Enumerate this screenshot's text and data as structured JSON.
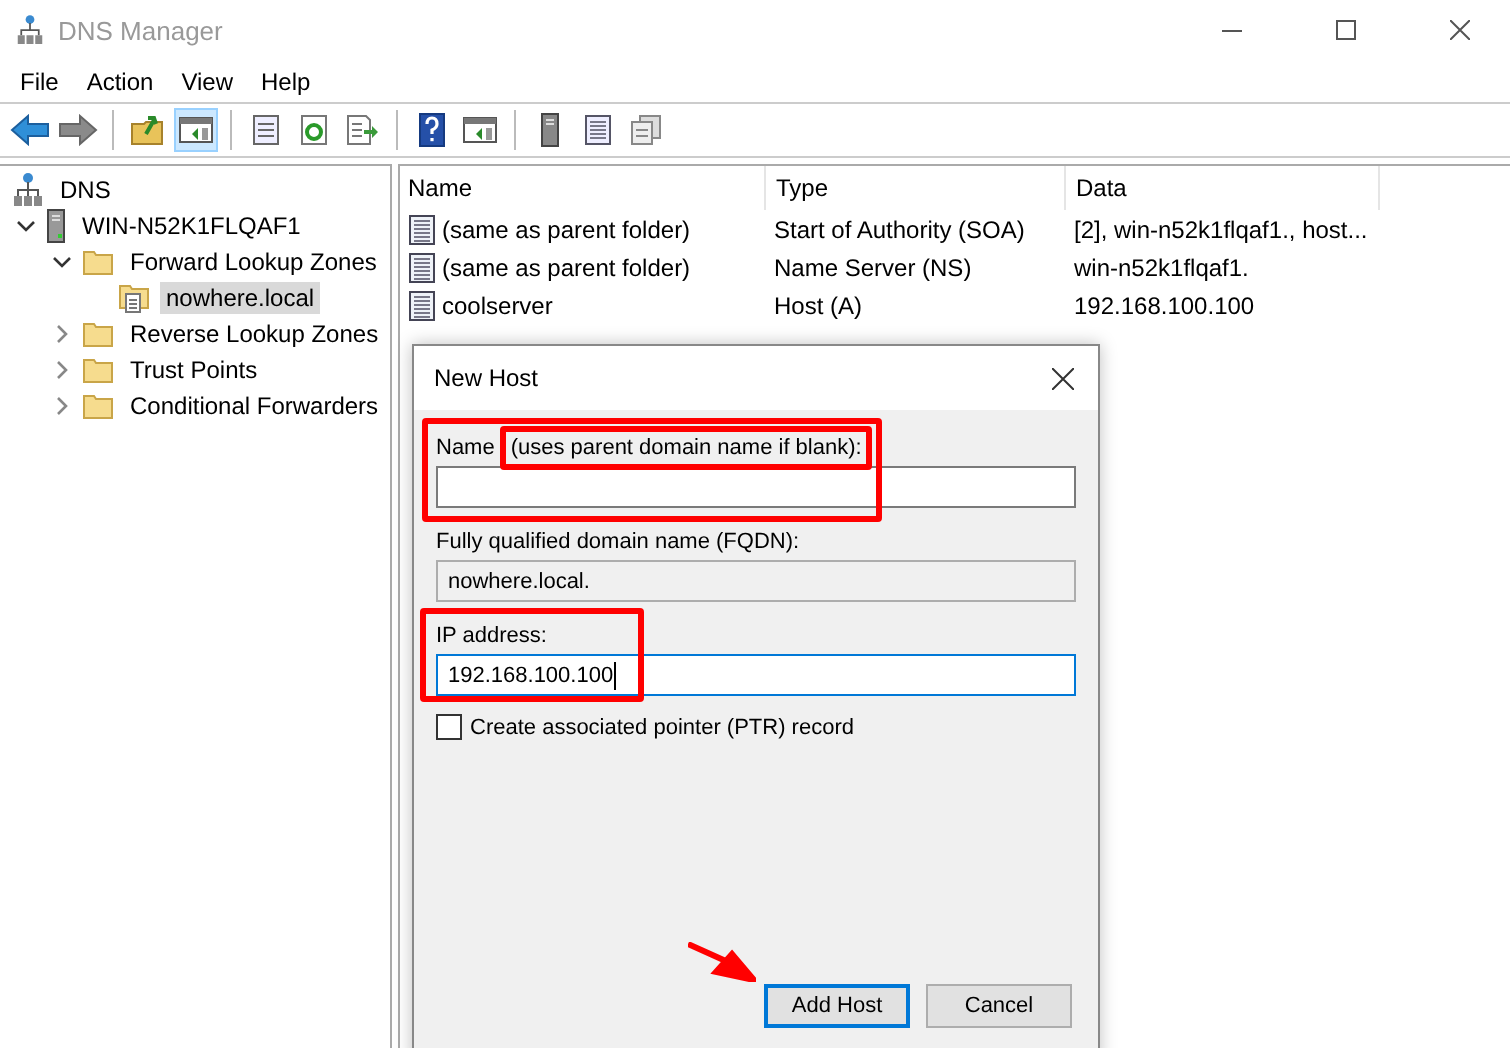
{
  "window": {
    "title": "DNS Manager"
  },
  "menu": [
    "File",
    "Action",
    "View",
    "Help"
  ],
  "toolbar": [
    {
      "kind": "back",
      "pressed": false
    },
    {
      "kind": "forward",
      "pressed": false
    },
    {
      "kind": "separator"
    },
    {
      "kind": "up-folder",
      "pressed": false
    },
    {
      "kind": "pane",
      "pressed": true
    },
    {
      "kind": "separator"
    },
    {
      "kind": "properties",
      "pressed": false
    },
    {
      "kind": "refresh",
      "pressed": false
    },
    {
      "kind": "export",
      "pressed": false
    },
    {
      "kind": "separator"
    },
    {
      "kind": "help",
      "pressed": false
    },
    {
      "kind": "pane",
      "pressed": false
    },
    {
      "kind": "separator"
    },
    {
      "kind": "server",
      "pressed": false
    },
    {
      "kind": "list",
      "pressed": false
    },
    {
      "kind": "copy",
      "pressed": false
    }
  ],
  "tree": [
    {
      "label": "DNS",
      "kind": "dns",
      "selected": false,
      "children": [
        {
          "label": "WIN-N52K1FLQAF1",
          "kind": "server",
          "expanded": true,
          "selected": false,
          "children": [
            {
              "label": "Forward Lookup Zones",
              "kind": "folder",
              "expanded": true,
              "selected": false,
              "children": [
                {
                  "label": "nowhere.local",
                  "kind": "zone",
                  "selected": true
                }
              ]
            },
            {
              "label": "Reverse Lookup Zones",
              "kind": "folder",
              "expanded": false,
              "selected": false
            },
            {
              "label": "Trust Points",
              "kind": "folder",
              "expanded": false,
              "selected": false
            },
            {
              "label": "Conditional Forwarders",
              "kind": "folder",
              "expanded": false,
              "selected": false
            }
          ]
        }
      ]
    }
  ],
  "table": {
    "columns": [
      "Name",
      "Type",
      "Data"
    ],
    "rows": [
      {
        "name": "(same as parent folder)",
        "type": "Start of Authority (SOA)",
        "data": "[2], win-n52k1flqaf1., host..."
      },
      {
        "name": "(same as parent folder)",
        "type": "Name Server (NS)",
        "data": "win-n52k1flqaf1."
      },
      {
        "name": "coolserver",
        "type": "Host (A)",
        "data": "192.168.100.100"
      }
    ]
  },
  "dialog": {
    "title": "New Host",
    "fields": [
      {
        "label": "Name",
        "label_note": "(uses parent domain name if blank):",
        "readonly": false,
        "highlighted": true,
        "label_highlighted": true
      },
      {
        "label": "Fully qualified domain name (FQDN):",
        "value": "nowhere.local.",
        "readonly": true,
        "highlighted": false
      },
      {
        "label": "IP address:",
        "value": "192.168.100.100",
        "readonly": false,
        "highlighted": true
      }
    ],
    "checkbox": {
      "label": "Create associated pointer (PTR) record",
      "checked": false
    },
    "buttons": [
      {
        "label": "Add Host",
        "default": true,
        "arrow": true
      },
      {
        "label": "Cancel",
        "default": false,
        "arrow": false
      }
    ]
  }
}
